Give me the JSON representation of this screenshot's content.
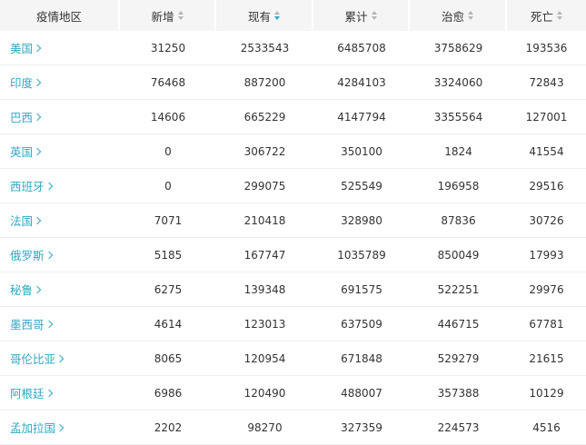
{
  "header": {
    "region": "疫情地区",
    "new": "新增",
    "current": "现有",
    "total": "累计",
    "cured": "治愈",
    "death": "死亡",
    "active_sort": "current",
    "accent_color": "#2fa8c4"
  },
  "rows": [
    {
      "region": "美国",
      "new": "31250",
      "current": "2533543",
      "total": "6485708",
      "cured": "3758629",
      "death": "193536"
    },
    {
      "region": "印度",
      "new": "76468",
      "current": "887200",
      "total": "4284103",
      "cured": "3324060",
      "death": "72843"
    },
    {
      "region": "巴西",
      "new": "14606",
      "current": "665229",
      "total": "4147794",
      "cured": "3355564",
      "death": "127001"
    },
    {
      "region": "英国",
      "new": "0",
      "current": "306722",
      "total": "350100",
      "cured": "1824",
      "death": "41554"
    },
    {
      "region": "西班牙",
      "new": "0",
      "current": "299075",
      "total": "525549",
      "cured": "196958",
      "death": "29516"
    },
    {
      "region": "法国",
      "new": "7071",
      "current": "210418",
      "total": "328980",
      "cured": "87836",
      "death": "30726"
    },
    {
      "region": "俄罗斯",
      "new": "5185",
      "current": "167747",
      "total": "1035789",
      "cured": "850049",
      "death": "17993"
    },
    {
      "region": "秘鲁",
      "new": "6275",
      "current": "139348",
      "total": "691575",
      "cured": "522251",
      "death": "29976"
    },
    {
      "region": "墨西哥",
      "new": "4614",
      "current": "123013",
      "total": "637509",
      "cured": "446715",
      "death": "67781"
    },
    {
      "region": "哥伦比亚",
      "new": "8065",
      "current": "120954",
      "total": "671848",
      "cured": "529279",
      "death": "21615"
    },
    {
      "region": "阿根廷",
      "new": "6986",
      "current": "120490",
      "total": "488007",
      "cured": "357388",
      "death": "10129"
    },
    {
      "region": "孟加拉国",
      "new": "2202",
      "current": "98270",
      "total": "327359",
      "cured": "224573",
      "death": "4516"
    }
  ]
}
